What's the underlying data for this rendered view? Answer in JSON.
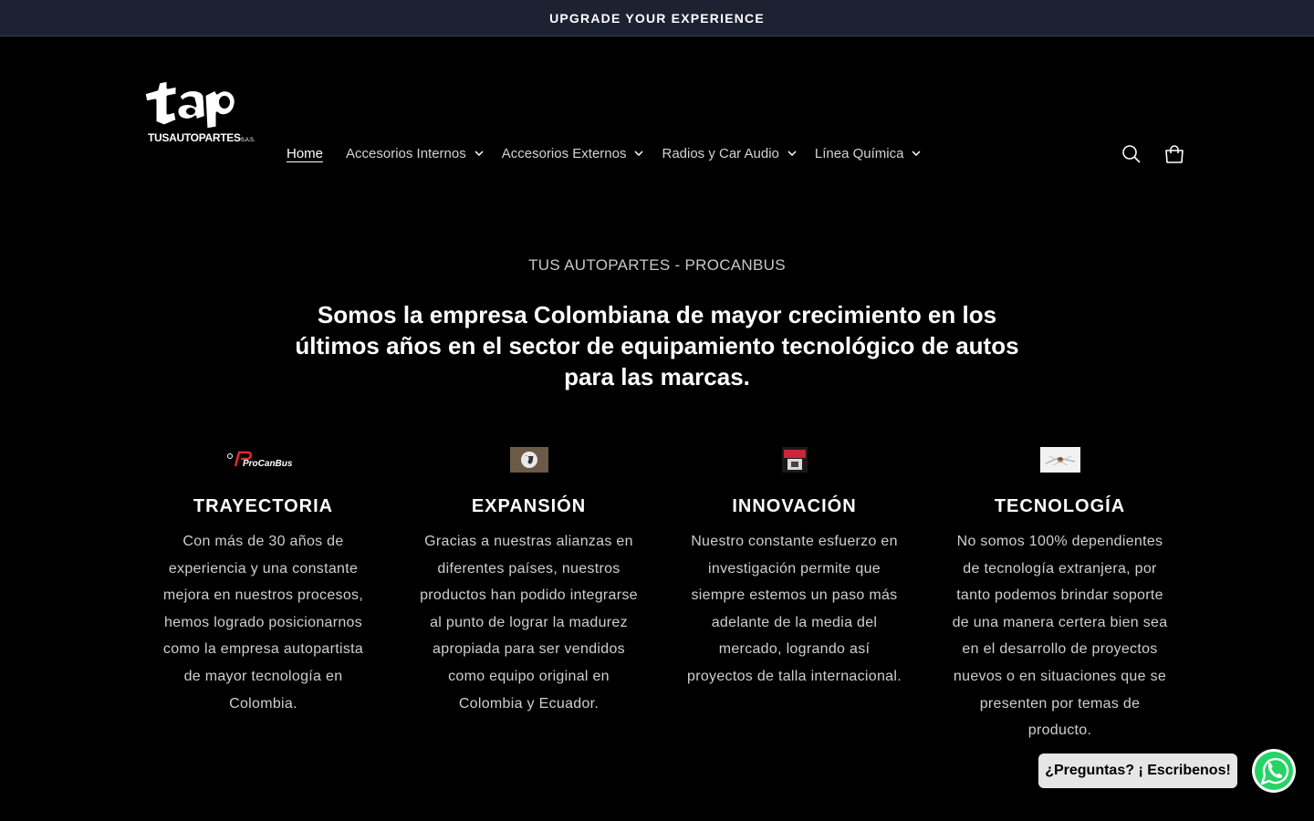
{
  "announcement": {
    "text": "UPGRADE YOUR EXPERIENCE"
  },
  "logo": {
    "word": "tap",
    "tagline_a": "TUS",
    "tagline_b": "AUTOPARTES",
    "tagline_c": "S.A.S."
  },
  "nav": {
    "items": [
      {
        "label": "Home",
        "has_dropdown": false,
        "active": true
      },
      {
        "label": "Accesorios Internos",
        "has_dropdown": true
      },
      {
        "label": "Accesorios Externos",
        "has_dropdown": true
      },
      {
        "label": "Radios y Car Audio",
        "has_dropdown": true
      },
      {
        "label": "Línea Química",
        "has_dropdown": true
      }
    ]
  },
  "header_icons": [
    "search-icon",
    "cart-icon"
  ],
  "intro": {
    "subheading": "TUS AUTOPARTES - PROCANBUS",
    "heading": "Somos la empresa Colombiana de mayor crecimiento en los últimos años en el sector de equipamiento tecnológico de autos para las marcas."
  },
  "columns": [
    {
      "image_text": "ProCanBus",
      "title": "TRAYECTORIA",
      "text": "Con más de 30 años de experiencia y una constante mejora en nuestros procesos, hemos logrado posicionarnos como la empresa autopartista de mayor tecnología en Colombia."
    },
    {
      "title": "EXPANSIÓN",
      "text": "Gracias a nuestras alianzas en diferentes países, nuestros productos han podido integrarse al punto de lograr la madurez apropiada para ser vendidos como equipo original en Colombia y Ecuador."
    },
    {
      "title": "INNOVACIÓN",
      "text": "Nuestro constante esfuerzo en investigación permite que siempre estemos un paso más adelante de la media del mercado, logrando así proyectos de talla internacional."
    },
    {
      "title": "TECNOLOGÍA",
      "text": "No somos 100% dependientes de tecnología extranjera, por tanto podemos brindar soporte de una manera certera bien sea en el desarrollo de proyectos nuevos o en situaciones que se presenten por temas de producto."
    }
  ],
  "chat": {
    "bubble_text": "¿Preguntas? ¡ Escribenos!",
    "icon": "whatsapp-icon"
  },
  "colors": {
    "announcement_bg": "#1d2233",
    "page_bg": "#000000",
    "whatsapp_green": "#25d366"
  }
}
